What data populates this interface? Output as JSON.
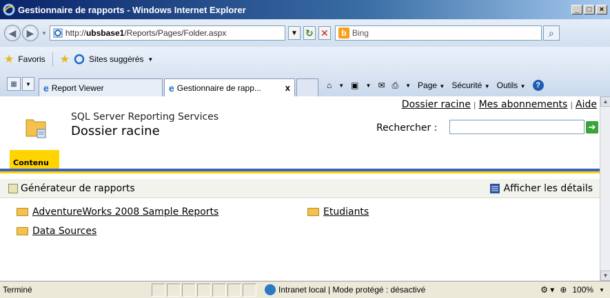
{
  "browser": {
    "window_title": "Gestionnaire de rapports - Windows Internet Explorer",
    "address": {
      "prefix": "http://",
      "host": "ubsbase1",
      "path": "/Reports/Pages/Folder.aspx"
    },
    "search_provider": "Bing",
    "favorites_label": "Favoris",
    "suggested_sites_label": "Sites suggérés",
    "tabs": [
      {
        "label": "Report Viewer"
      },
      {
        "label": "Gestionnaire de rapp...",
        "close": "x"
      }
    ],
    "command_bar": {
      "page": "Page",
      "security": "Sécurité",
      "tools": "Outils"
    },
    "status": {
      "text": "Terminé",
      "zone": "Intranet local | Mode protégé : désactivé",
      "zoom": "100%"
    }
  },
  "page": {
    "top_links": [
      "Dossier racine",
      "Mes abonnements",
      "Aide"
    ],
    "link_separator": "|",
    "product_name": "SQL Server Reporting Services",
    "title": "Dossier racine",
    "search_label": "Rechercher :",
    "active_tab": "Contenu",
    "toolbar": {
      "report_builder": "Générateur de rapports",
      "show_details": "Afficher les détails"
    },
    "items": [
      {
        "name": "AdventureWorks 2008 Sample Reports"
      },
      {
        "name": "Etudiants"
      },
      {
        "name": "Data Sources"
      }
    ]
  },
  "colors": {
    "accent_yellow": "#ffd400",
    "accent_blue": "#3b63c6",
    "titlebar": "#0a246a"
  }
}
